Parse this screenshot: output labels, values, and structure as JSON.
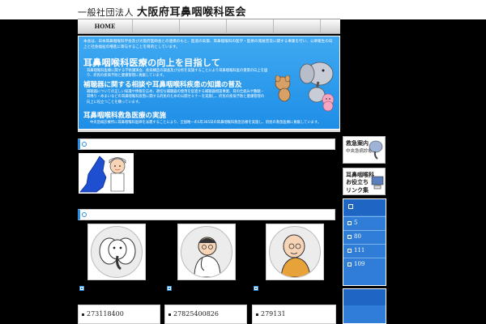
{
  "header": {
    "org_type": "一般社団法人",
    "org_name": "大阪府耳鼻咽喉科医会"
  },
  "nav": {
    "items": [
      "HOME",
      "",
      "",
      "",
      ""
    ]
  },
  "banner": {
    "intro": "本会は、日本耳鼻咽喉科学会及び大阪府医師会との連携のもと、医道の高揚、耳鼻咽喉科の医学・医術の発展普及に関する事業を行い、公衆衛生の向上と社会福祉の増進に寄与することを目的としています。",
    "heading1": "耳鼻咽喉科医療の向上を目指して",
    "para1": "耳鼻咽喉科医療に関する学術講演会、疾病構造の調査及び分析を実施することにより耳鼻咽喉科医の資質の向上を図り、府民の疾病予防と健康管理に貢献しています。",
    "heading2": "補聴器に関する相談や耳鼻咽喉科疾患の知識の普及",
    "para2": "補聴器についての正しい知識や情報を広め、適切な補聴器の使用を促進する補聴器相談事業、耳の仕組みや難聴・耳鳴り・めまいなどの耳鼻咽喉科疾患に関する府民のための公開セミナーを実施し、府民の疾病予防と健康管理の向上に役立つことを願っています。",
    "heading3": "耳鼻咽喉科救急医療の実施",
    "para3": "中央急病診療所に耳鼻咽喉科医師を派遣することにより、全国唯一の1年365日の耳鼻咽喉科救急診療を実施し、府民の救急医療に貢献しています。"
  },
  "sidebar": {
    "emergency": {
      "title": "救急案内",
      "subtitle": "中央急病診療所"
    },
    "links": {
      "title": "耳鼻咽喉科",
      "subtitle": "お役立ち",
      "title2": "リンク集"
    },
    "items": [
      {
        "label": "5"
      },
      {
        "label": "80"
      },
      {
        "label": "111"
      },
      {
        "label": "109"
      }
    ]
  },
  "stats": [
    "273118400",
    "27825400826",
    "279131"
  ],
  "colors": {
    "accent": "#2a8ee0",
    "banner": "#3fa9f2",
    "side_panel": "#2f7dd6"
  }
}
